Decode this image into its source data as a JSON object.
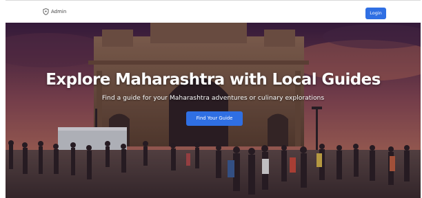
{
  "navbar": {
    "admin_label": "Admin",
    "admin_icon": "shield-icon",
    "login_label": "Login"
  },
  "hero": {
    "title": "Explore Maharashtra with Local Guides",
    "subtitle": "Find a guide for your Maharashtra adventures or culinary explorations",
    "cta_label": "Find Your Guide",
    "background_image": "gateway-of-india-photo"
  },
  "colors": {
    "accent": "#2f6fe3",
    "hero_text": "#ffffff",
    "nav_text": "#444444"
  }
}
